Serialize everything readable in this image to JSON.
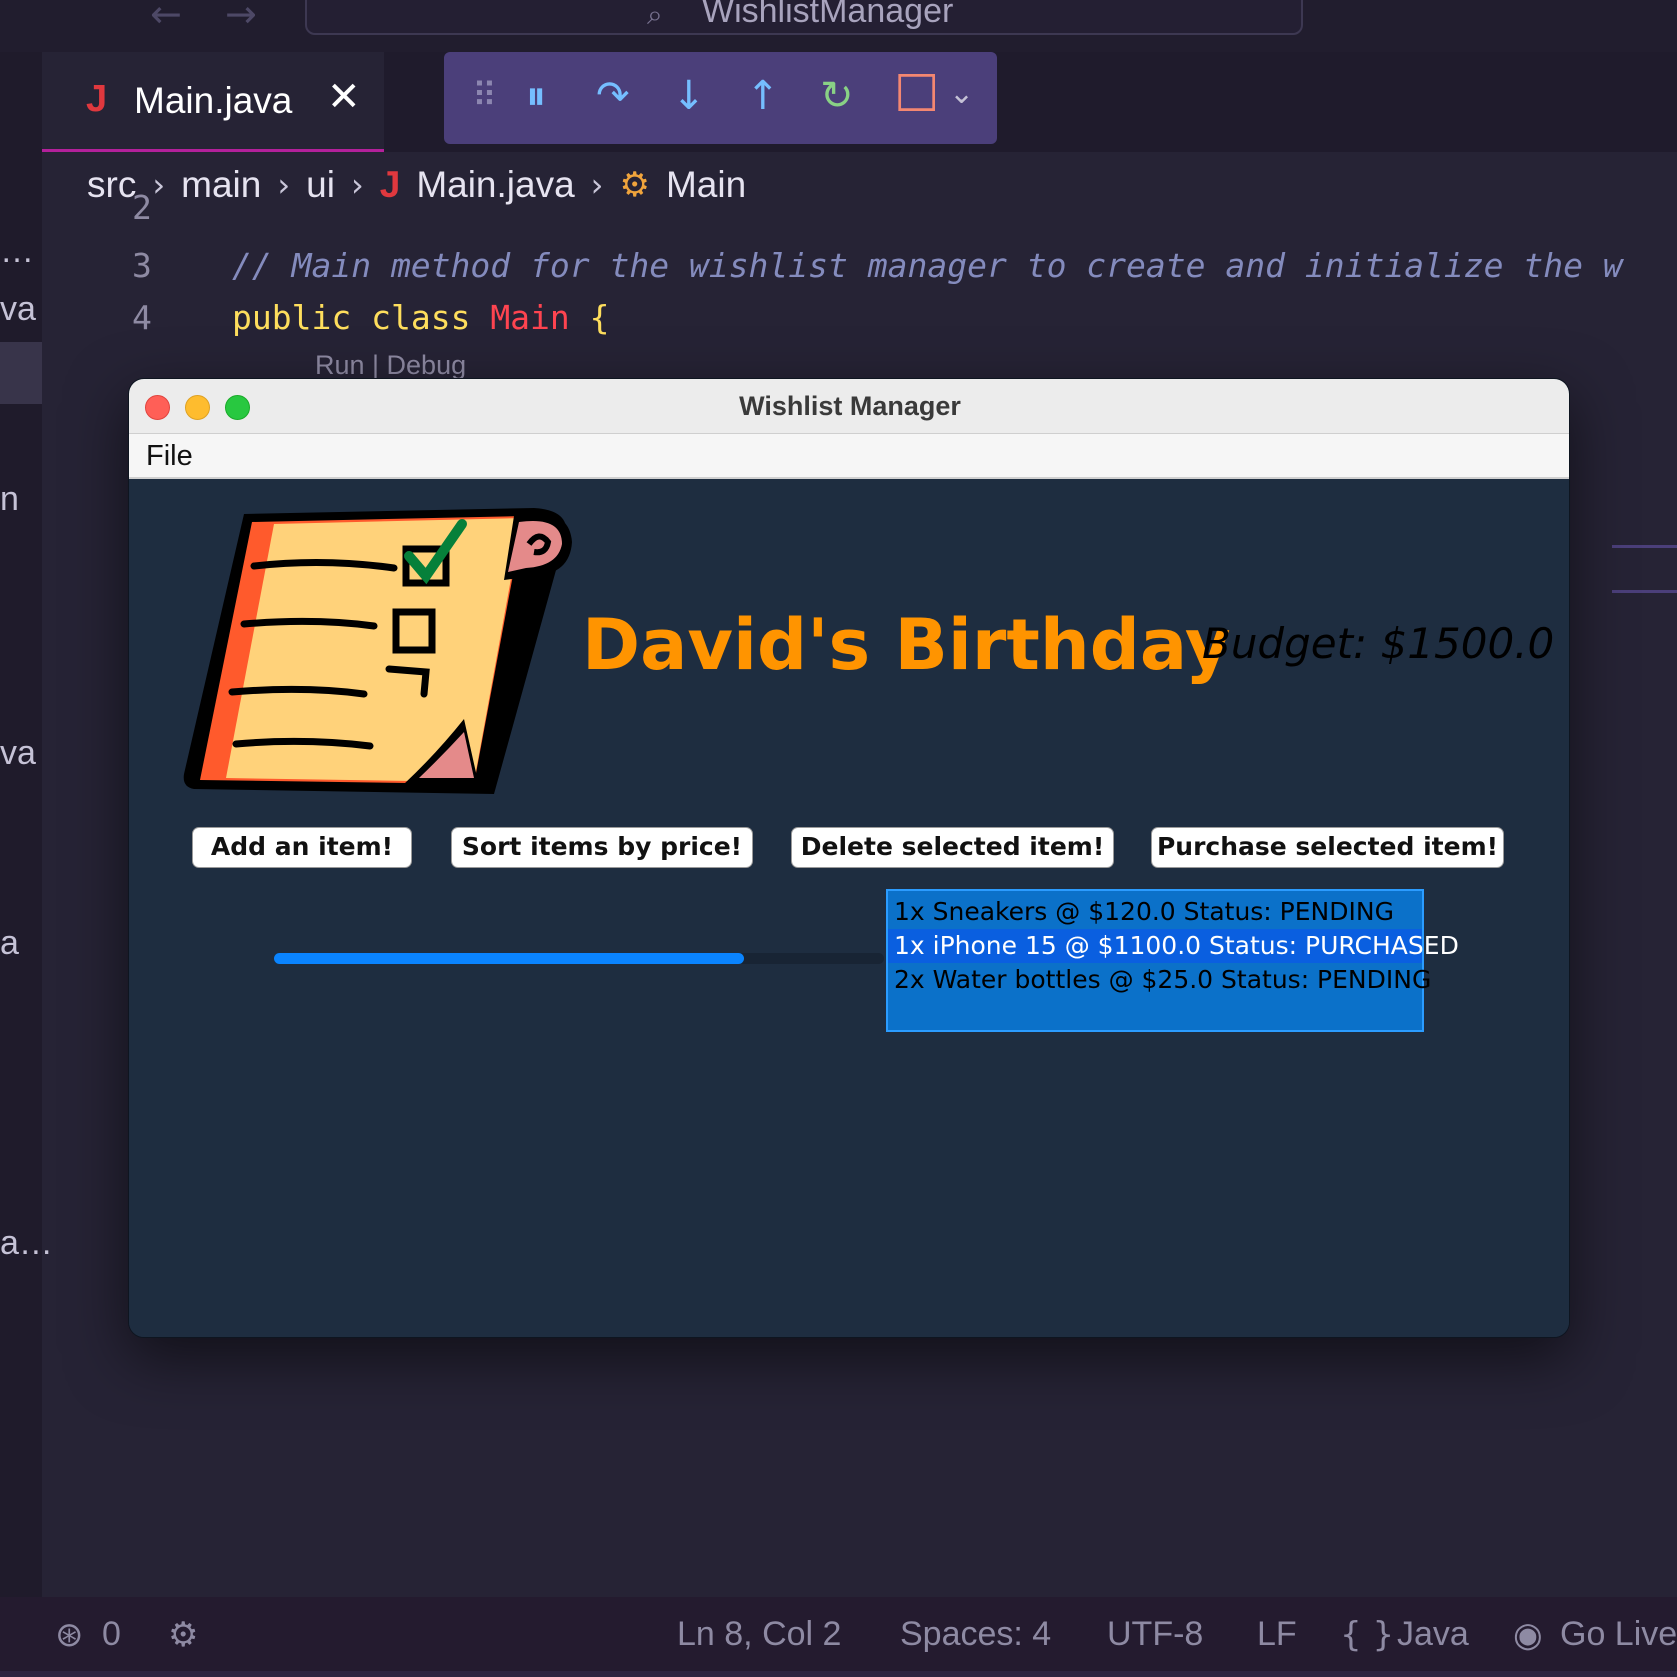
{
  "vscode": {
    "command_center": {
      "text": "WishlistManager"
    },
    "nav": {
      "back": "←",
      "forward": "→"
    },
    "activity": {
      "items": [
        "…",
        "va",
        "n",
        "va",
        "a",
        "a…"
      ]
    },
    "tab": {
      "icon": "J",
      "title": "Main.java",
      "close": "✕"
    },
    "debug_toolbar": {
      "grip": "⠿",
      "pause": "⏸",
      "step_over": "↷",
      "step_into": "↓",
      "step_out": "↑",
      "restart": "↻",
      "stop": "□",
      "more": "⌄"
    },
    "breadcrumb": {
      "items": [
        "src",
        "main",
        "ui",
        "Main.java",
        "Main"
      ],
      "sep": "›"
    },
    "editor": {
      "line_numbers": [
        "2",
        "3",
        "4"
      ],
      "comment": "// Main method for the wishlist manager to create and initialize the w",
      "kw_public": "public",
      "kw_class": "class",
      "class_name": "Main",
      "brace": "{",
      "codelens": "Run | Debug"
    },
    "statusbar": {
      "ports": "0",
      "position": "Ln 8, Col 2",
      "spaces": "Spaces: 4",
      "encoding": "UTF-8",
      "eol": "LF",
      "language": "Java",
      "golive": "Go Live"
    }
  },
  "app": {
    "window_title": "Wishlist Manager",
    "menu": [
      "File"
    ],
    "heading": "David's Birthday",
    "budget": "Budget: $1500.0",
    "buttons": {
      "add": "Add an item!",
      "sort": "Sort items by price!",
      "delete": "Delete selected item!",
      "purchase": "Purchase selected item!"
    },
    "progress": {
      "value": 0.77
    },
    "items": [
      {
        "text": "1x Sneakers @ $120.0 Status: PENDING",
        "selected": false
      },
      {
        "text": "1x iPhone 15 @ $1100.0 Status: PURCHASED",
        "selected": true
      },
      {
        "text": "2x Water bottles @ $25.0 Status: PENDING",
        "selected": false
      }
    ]
  },
  "colors": {
    "accent_orange": "#ff9400",
    "list_bg": "#0b71c9",
    "progress_fill": "#0a84ff",
    "window_bg": "#1e2d40"
  }
}
